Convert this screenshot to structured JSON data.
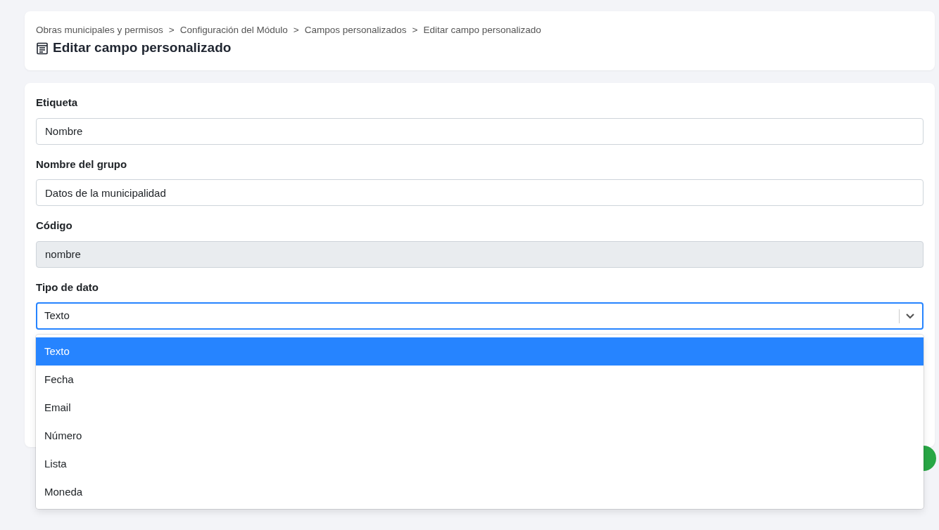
{
  "breadcrumb": {
    "separator": ">",
    "items": [
      "Obras municipales y permisos",
      "Configuración del Módulo",
      "Campos personalizados",
      "Editar campo personalizado"
    ]
  },
  "page_title": "Editar campo personalizado",
  "fields": [
    {
      "kind": "text",
      "label": "Etiqueta",
      "value": "Nombre",
      "disabled": false
    },
    {
      "kind": "text",
      "label": "Nombre del grupo",
      "value": "Datos de la municipalidad",
      "disabled": false
    },
    {
      "kind": "text",
      "label": "Código",
      "value": "nombre",
      "disabled": true
    },
    {
      "kind": "select",
      "label": "Tipo de dato",
      "value": "Texto",
      "expanded": true,
      "options": [
        {
          "label": "Texto",
          "selected": true
        },
        {
          "label": "Fecha",
          "selected": false
        },
        {
          "label": "Email",
          "selected": false
        },
        {
          "label": "Número",
          "selected": false
        },
        {
          "label": "Lista",
          "selected": false
        },
        {
          "label": "Moneda",
          "selected": false
        }
      ]
    }
  ]
}
